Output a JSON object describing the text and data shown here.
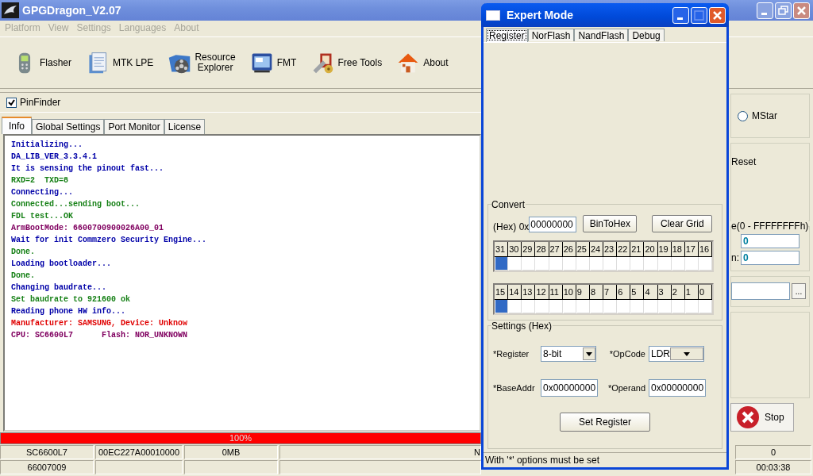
{
  "window": {
    "title": "GPGDragon_V2.07"
  },
  "menu": [
    {
      "label": "Platform",
      "disabled": true
    },
    {
      "label": "View",
      "disabled": true
    },
    {
      "label": "Settings",
      "disabled": true
    },
    {
      "label": "Languages",
      "disabled": true
    },
    {
      "label": "About",
      "disabled": true
    }
  ],
  "toolbar": [
    {
      "label": "Flasher",
      "kind": "phone"
    },
    {
      "label": "MTK LPE",
      "kind": "document"
    },
    {
      "label": "Resource Explorer",
      "kind": "reel"
    },
    {
      "label": "FMT",
      "kind": "monitor"
    },
    {
      "label": "Free Tools",
      "kind": "tools"
    },
    {
      "label": "About",
      "kind": "house"
    }
  ],
  "pinfinder": {
    "label": "PinFinder",
    "checked": true
  },
  "tabs": [
    {
      "label": "Info",
      "selected": true
    },
    {
      "label": "Global Settings",
      "selected": false
    },
    {
      "label": "Port Monitor",
      "selected": false
    },
    {
      "label": "License",
      "selected": false
    }
  ],
  "log": [
    {
      "text": "Initializing...",
      "color": "#0000a8"
    },
    {
      "text": "DA_LIB_VER_3.3.4.1",
      "color": "#0000a8"
    },
    {
      "text": "It is sensing the pinout fast...",
      "color": "#0000a8"
    },
    {
      "text": "RXD=2  TXD=8",
      "color": "#168016"
    },
    {
      "text": "Connecting...",
      "color": "#0000a8"
    },
    {
      "text": "Connected...sending boot...",
      "color": "#168016"
    },
    {
      "text": "FDL test...OK",
      "color": "#168016"
    },
    {
      "text": "ArmBootMode: 6600700900026A00_01",
      "color": "#800060"
    },
    {
      "text": "Wait for init Commzero Security Engine...",
      "color": "#0000a8"
    },
    {
      "text": "Done.",
      "color": "#168016"
    },
    {
      "text": "Loading bootloader...",
      "color": "#0000a8"
    },
    {
      "text": "Done.",
      "color": "#168016"
    },
    {
      "text": "Changing baudrate...",
      "color": "#0000a8"
    },
    {
      "text": "Set baudrate to 921600 ok",
      "color": "#168016"
    },
    {
      "text": "Reading phone HW info...",
      "color": "#0000a8"
    },
    {
      "text": "Manufacturer: SAMSUNG, Device: Unknow",
      "color": "#e00000"
    },
    {
      "text": "CPU: SC6600L7      Flash: NOR_UNKNOWN",
      "color": "#800060"
    }
  ],
  "right_panel": {
    "radio": {
      "label": "MStar",
      "selected": false
    },
    "reset_label": "Reset",
    "range_label": "e(0 - FFFFFFFFh)",
    "field_1": "0",
    "field_2_label": "n:",
    "field_2": "0",
    "browse_button": "...",
    "stop_button": "Stop"
  },
  "progress": {
    "level": 1,
    "text": "100%"
  },
  "status_bar": {
    "row_1": {
      "column_1": "SC6600L7",
      "column_2": "00EC227A00010000",
      "column_3": "0MB",
      "column_4": "N",
      "column_5": "0"
    },
    "row_2": {
      "column_1": "66007009",
      "column_5": "00:03:38"
    }
  },
  "dialog": {
    "title": "Expert Mode",
    "tabs": [
      {
        "label": "Register",
        "selected": true
      },
      {
        "label": "NorFlash",
        "selected": false
      },
      {
        "label": "NandFlash",
        "selected": false
      },
      {
        "label": "Debug",
        "selected": false
      }
    ],
    "convert": {
      "title": "Convert",
      "hex_label": "(Hex) 0x",
      "hex_value": "00000000",
      "buttons": [
        "BinToHex",
        "Clear Grid"
      ],
      "grids": [
        {
          "bits": [
            {
              "label": "31",
              "selected": true
            },
            {
              "label": "30",
              "selected": false
            },
            {
              "label": "29",
              "selected": false
            },
            {
              "label": "28",
              "selected": false
            },
            {
              "label": "27",
              "selected": false
            },
            {
              "label": "26",
              "selected": false
            },
            {
              "label": "25",
              "selected": false
            },
            {
              "label": "24",
              "selected": false
            },
            {
              "label": "23",
              "selected": false
            },
            {
              "label": "22",
              "selected": false
            },
            {
              "label": "21",
              "selected": false
            },
            {
              "label": "20",
              "selected": false
            },
            {
              "label": "19",
              "selected": false
            },
            {
              "label": "18",
              "selected": false
            },
            {
              "label": "17",
              "selected": false
            },
            {
              "label": "16",
              "selected": false
            }
          ]
        },
        {
          "bits": [
            {
              "label": "15",
              "selected": true
            },
            {
              "label": "14",
              "selected": false
            },
            {
              "label": "13",
              "selected": false
            },
            {
              "label": "12",
              "selected": false
            },
            {
              "label": "11",
              "selected": false
            },
            {
              "label": "10",
              "selected": false
            },
            {
              "label": "9",
              "selected": false
            },
            {
              "label": "8",
              "selected": false
            },
            {
              "label": "7",
              "selected": false
            },
            {
              "label": "6",
              "selected": false
            },
            {
              "label": "5",
              "selected": false
            },
            {
              "label": "4",
              "selected": false
            },
            {
              "label": "3",
              "selected": false
            },
            {
              "label": "2",
              "selected": false
            },
            {
              "label": "1",
              "selected": false
            },
            {
              "label": "0",
              "selected": false
            }
          ]
        }
      ]
    },
    "settings": {
      "title": "Settings (Hex)",
      "fields": [
        {
          "label": "*Register",
          "value": "8-bit",
          "kind": "dropdown"
        },
        {
          "label": "*OpCode",
          "value": "LDR",
          "kind": "dropdown"
        },
        {
          "label": "*BaseAddr",
          "value": "0x00000000",
          "kind": "text"
        },
        {
          "label": "*Operand",
          "value": "0x00000000",
          "kind": "text"
        }
      ],
      "button": "Set Register"
    },
    "status": "With '*' options must be set"
  }
}
